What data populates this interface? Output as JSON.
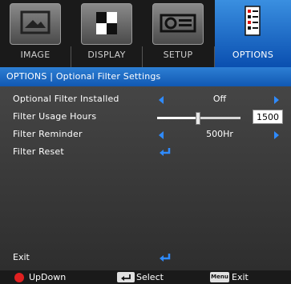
{
  "tabs": [
    {
      "label": "IMAGE",
      "icon": "image-icon"
    },
    {
      "label": "DISPLAY",
      "icon": "display-icon"
    },
    {
      "label": "SETUP",
      "icon": "projector-icon"
    },
    {
      "label": "OPTIONS",
      "icon": "options-icon",
      "active": true
    }
  ],
  "title": "OPTIONS | Optional Filter Settings",
  "rows": {
    "filter_installed": {
      "label": "Optional Filter Installed",
      "value": "Off"
    },
    "usage_hours": {
      "label": "Filter Usage Hours",
      "value": "1500",
      "level": 0.48
    },
    "reminder": {
      "label": "Filter Reminder",
      "value": "500Hr"
    },
    "reset": {
      "label": "Filter Reset"
    }
  },
  "exit_label": "Exit",
  "footer": {
    "updown": "UpDown",
    "select": "Select",
    "menu_key": "Menu",
    "exit": "Exit"
  },
  "colors": {
    "accent": "#1f6fd0",
    "arrow": "#2f8bff",
    "updown": "#e02020"
  }
}
